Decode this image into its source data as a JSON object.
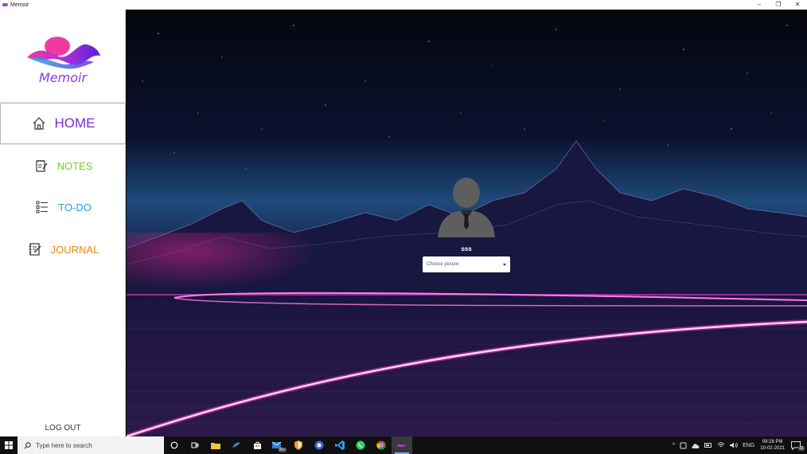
{
  "window": {
    "title": "Memoir",
    "controls": {
      "minimize": "–",
      "restore": "❐",
      "close": "✕"
    }
  },
  "sidebar": {
    "logo_text": "Memoir",
    "items": [
      {
        "label": "HOME",
        "icon": "home-icon",
        "active": true
      },
      {
        "label": "NOTES",
        "icon": "notes-icon",
        "active": false
      },
      {
        "label": "TO-DO",
        "icon": "todo-list-icon",
        "active": false
      },
      {
        "label": "JOURNAL",
        "icon": "journal-icon",
        "active": false
      }
    ],
    "logout_label": "LOG OUT"
  },
  "profile": {
    "username": "sss",
    "picker_label": "Choose picture"
  },
  "taskbar": {
    "search_placeholder": "Type here to search",
    "mail_badge": "99+",
    "tray_language": "ENG",
    "time": "09:28 PM",
    "date": "10-02-2021",
    "notification_count": "21"
  },
  "colors": {
    "accent_purple": "#7a2ad6",
    "notes_green": "#7bc82c",
    "todo_blue": "#2b9bd6",
    "journal_orange": "#e58b18"
  }
}
